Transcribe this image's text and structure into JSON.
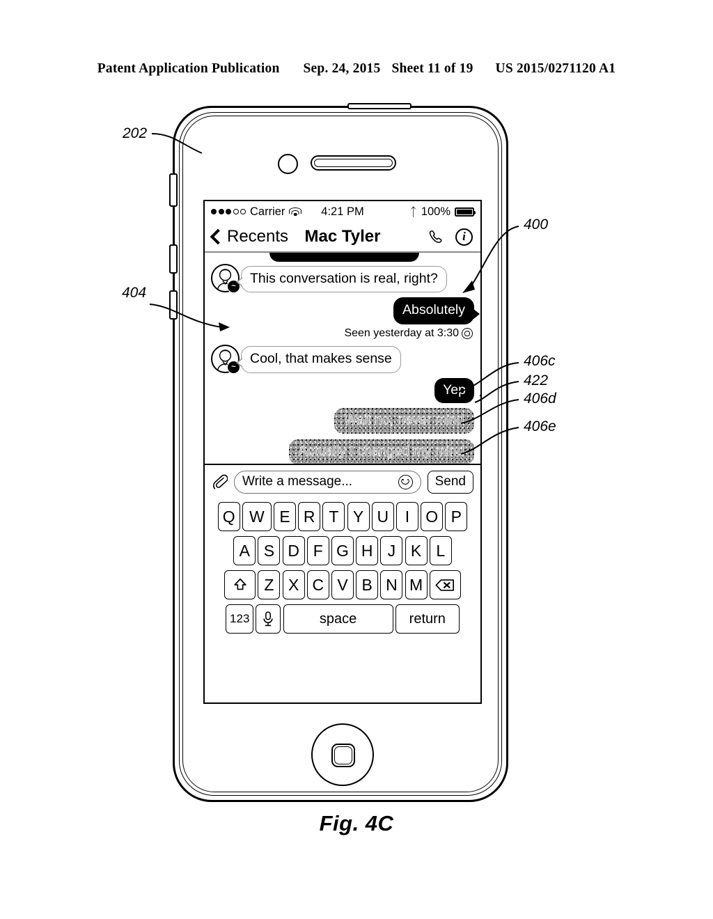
{
  "patent_header": {
    "publication": "Patent Application Publication",
    "date": "Sep. 24, 2015",
    "sheet": "Sheet 11 of 19",
    "number": "US 2015/0271120 A1"
  },
  "figure": {
    "caption": "Fig. 4C"
  },
  "reference_numerals": [
    {
      "id": "202",
      "label": "202"
    },
    {
      "id": "400",
      "label": "400"
    },
    {
      "id": "404",
      "label": "404"
    },
    {
      "id": "406c",
      "label": "406c"
    },
    {
      "id": "422",
      "label": "422"
    },
    {
      "id": "406d",
      "label": "406d"
    },
    {
      "id": "406e",
      "label": "406e"
    }
  ],
  "device": {
    "status_bar": {
      "signal_dots_filled": 3,
      "signal_dots_total": 5,
      "carrier": "Carrier",
      "wifi_icon": "wifi-icon",
      "time": "4:21 PM",
      "bluetooth_icon": "bluetooth-icon",
      "battery_percent": "100%",
      "battery_icon": "battery-icon"
    },
    "nav_bar": {
      "back_label": "Recents",
      "back_icon": "chevron-left-icon",
      "title": "Mac Tyler",
      "call_icon": "phone-icon",
      "info_icon": "info-icon"
    },
    "conversation": {
      "messages": [
        {
          "id": "cut-off",
          "side": "outgoing",
          "style": "dark",
          "text": "",
          "partial": true
        },
        {
          "id": "m1",
          "side": "incoming",
          "style": "light",
          "text": "This conversation is real, right?",
          "avatar": "contact-avatar",
          "badge": "messenger-badge"
        },
        {
          "id": "m2",
          "side": "outgoing",
          "style": "dark",
          "text": "Absolutely"
        },
        {
          "id": "m3",
          "side": "incoming",
          "style": "light",
          "text": "Cool, that makes sense",
          "avatar": "contact-avatar",
          "badge": "messenger-badge"
        },
        {
          "id": "m4",
          "ref": "406c",
          "side": "outgoing",
          "style": "dark",
          "text": "Yep"
        },
        {
          "id": "m5",
          "ref": "406d",
          "side": "outgoing",
          "style": "redacted",
          "text": "Wait no, never mind"
        },
        {
          "id": "m6",
          "ref": "406e",
          "side": "outgoing",
          "style": "redacted",
          "text": "Actually I changed my mind"
        }
      ],
      "seen_receipt": {
        "text": "Seen yesterday at 3:30",
        "avatar_icon": "seen-avatar-icon"
      },
      "delivery_check": {
        "ref": "422",
        "icon": "checkmark-icon"
      }
    },
    "input_bar": {
      "attach_icon": "paperclip-icon",
      "placeholder": "Write a message...",
      "emoji_icon": "smiley-icon",
      "send_label": "Send"
    },
    "keyboard": {
      "row1": [
        "Q",
        "W",
        "E",
        "R",
        "T",
        "Y",
        "U",
        "I",
        "O",
        "P"
      ],
      "row2": [
        "A",
        "S",
        "D",
        "F",
        "G",
        "H",
        "J",
        "K",
        "L"
      ],
      "row3_shift_icon": "shift-icon",
      "row3": [
        "Z",
        "X",
        "C",
        "V",
        "B",
        "N",
        "M"
      ],
      "row3_backspace_icon": "backspace-icon",
      "row4_numbers": "123",
      "row4_mic_icon": "microphone-icon",
      "row4_space": "space",
      "row4_return": "return"
    },
    "hardware": {
      "camera_icon": "front-camera",
      "speaker_icon": "earpiece-speaker",
      "home_button": "home-button",
      "side_buttons": [
        "silent-switch",
        "volume-up-button",
        "volume-down-button"
      ],
      "top_button": "power-button"
    }
  }
}
